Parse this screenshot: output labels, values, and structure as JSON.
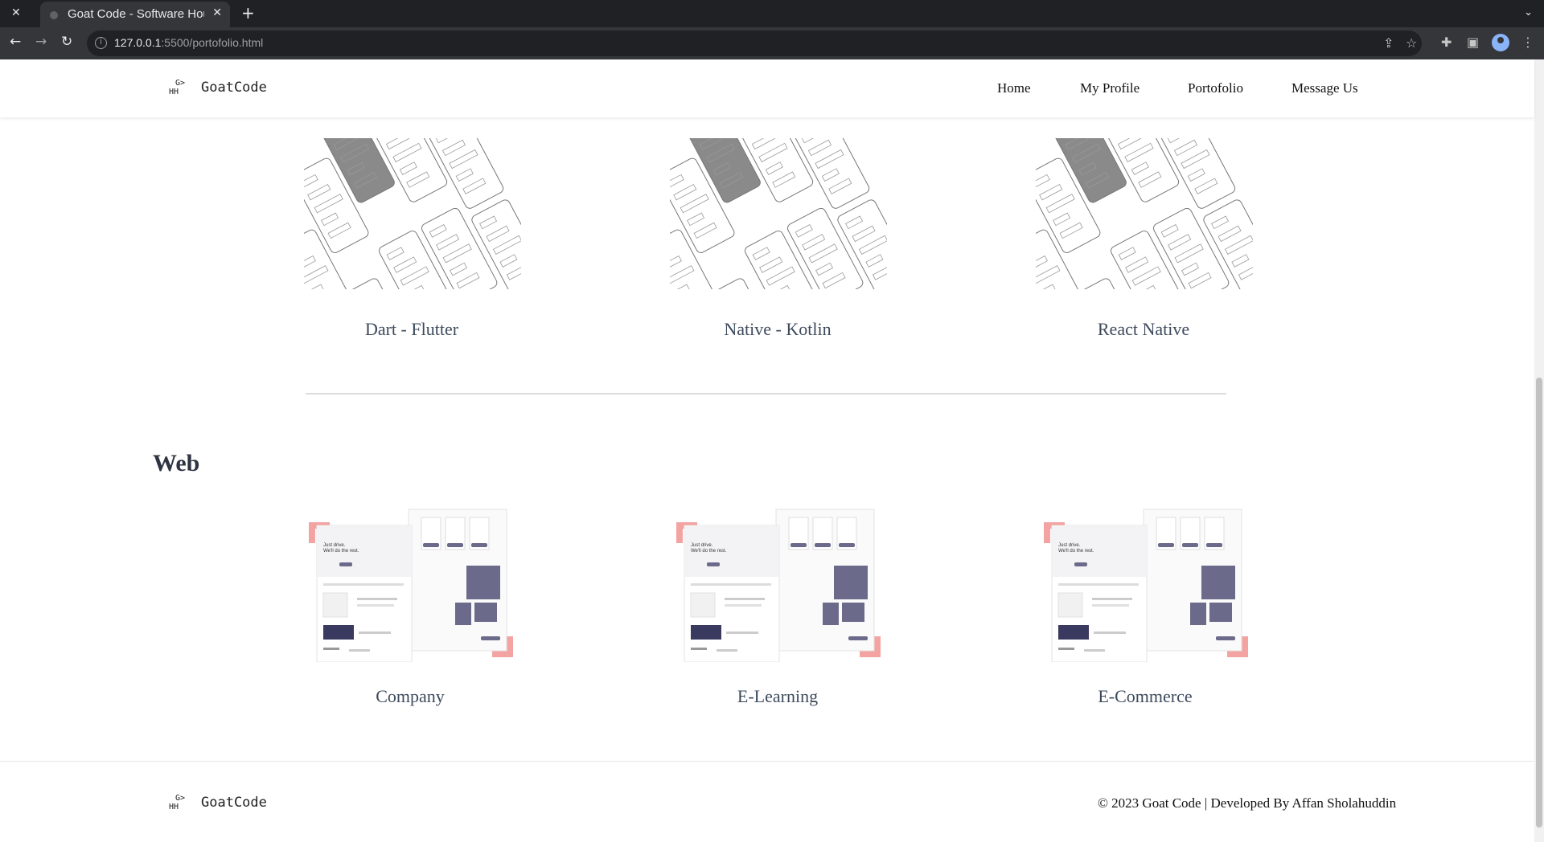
{
  "browser": {
    "tab_title": "Goat Code - Software House",
    "url_host": "127.0.0.1",
    "url_rest": ":5500/portofolio.html"
  },
  "site": {
    "logo_mark_top": "G>",
    "logo_mark_bottom": "HH",
    "logo_text": "GoatCode",
    "nav": [
      "Home",
      "My Profile",
      "Portofolio",
      "Message Us"
    ]
  },
  "mobile": {
    "items": [
      "Dart - Flutter",
      "Native - Kotlin",
      "React Native"
    ]
  },
  "web": {
    "heading": "Web",
    "items": [
      "Company",
      "E-Learning",
      "E-Commerce"
    ],
    "mock_text": {
      "hero_line1": "Just drive.",
      "hero_line2": "We'll do the rest."
    }
  },
  "footer": {
    "copyright": "© 2023 Goat Code | Developed By Affan Sholahuddin"
  },
  "colors": {
    "accent_corner": "#f4a3a3",
    "mock_purple": "#6c6a8a",
    "mock_dark": "#3a3960"
  }
}
